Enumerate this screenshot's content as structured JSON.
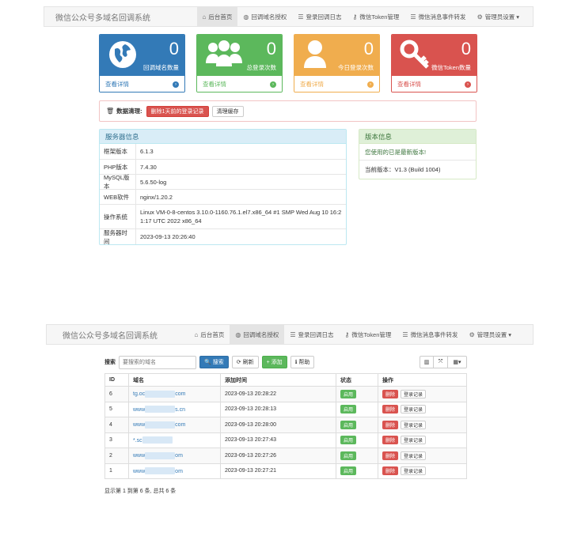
{
  "app_title": "微信公众号多域名回调系统",
  "nav": [
    {
      "label": "后台首页",
      "icon": "home-icon"
    },
    {
      "label": "回调域名授权",
      "icon": "globe-icon"
    },
    {
      "label": "登录回调日志",
      "icon": "list-icon"
    },
    {
      "label": "微信Token管理",
      "icon": "key-icon"
    },
    {
      "label": "微信消息事件转发",
      "icon": "list-icon"
    },
    {
      "label": "管理员设置",
      "icon": "gear-icon"
    }
  ],
  "stats": [
    {
      "value": "0",
      "label": "回调域名数量",
      "link": "查看详情",
      "color": "#337ab7",
      "icon": "globe-icon"
    },
    {
      "value": "0",
      "label": "总登录次数",
      "link": "查看详情",
      "color": "#5cb85c",
      "icon": "users-icon"
    },
    {
      "value": "0",
      "label": "今日登录次数",
      "link": "查看详情",
      "color": "#f0ad4e",
      "icon": "user-icon"
    },
    {
      "value": "0",
      "label": "微信Token数量",
      "link": "查看详情",
      "color": "#d9534f",
      "icon": "key-icon"
    }
  ],
  "cleanup": {
    "label": "数据清理:",
    "delete_button": "删除1天前的登录记录",
    "clear_cache_button": "清理缓存"
  },
  "server_info": {
    "title": "服务器信息",
    "rows": [
      {
        "key": "框架版本",
        "value": "6.1.3"
      },
      {
        "key": "PHP版本",
        "value": "7.4.30"
      },
      {
        "key": "MySQL版本",
        "value": "5.6.50-log"
      },
      {
        "key": "WEB软件",
        "value": "nginx/1.20.2"
      },
      {
        "key": "操作系统",
        "value": "Linux VM-0-8-centos 3.10.0-1160.76.1.el7.x86_64 #1 SMP Wed Aug 10 16:21:17 UTC 2022 x86_64"
      },
      {
        "key": "服务器时间",
        "value": "2023-09-13 20:26:40"
      }
    ]
  },
  "version_info": {
    "title": "版本信息",
    "latest_msg": "您使用的已是最新版本!",
    "current": "当前版本：V1.3 (Build 1004)"
  },
  "domain_page": {
    "search_label": "搜索",
    "search_placeholder": "要搜索的域名",
    "search_button": "搜索",
    "refresh_button": "刷新",
    "add_button": "添加",
    "help_button": "帮助",
    "columns": [
      "ID",
      "域名",
      "添加时间",
      "状态",
      "操作"
    ],
    "rows": [
      {
        "id": "6",
        "domain_prefix": "tg.oc",
        "domain_suffix": "com",
        "time": "2023-09-13 20:28:22"
      },
      {
        "id": "5",
        "domain_prefix": "www",
        "domain_suffix": "s.cn",
        "time": "2023-09-13 20:28:13"
      },
      {
        "id": "4",
        "domain_prefix": "www",
        "domain_suffix": "com",
        "time": "2023-09-13 20:28:00"
      },
      {
        "id": "3",
        "domain_prefix": "*.sc",
        "domain_suffix": "",
        "time": "2023-09-13 20:27:43"
      },
      {
        "id": "2",
        "domain_prefix": "www",
        "domain_suffix": "om",
        "time": "2023-09-13 20:27:26"
      },
      {
        "id": "1",
        "domain_prefix": "www",
        "domain_suffix": "om",
        "time": "2023-09-13 20:27:21"
      }
    ],
    "status_label": "启用",
    "delete_label": "删除",
    "log_label": "登录记录",
    "footer": "显示第 1 到第 6 条, 总共 6 条"
  }
}
